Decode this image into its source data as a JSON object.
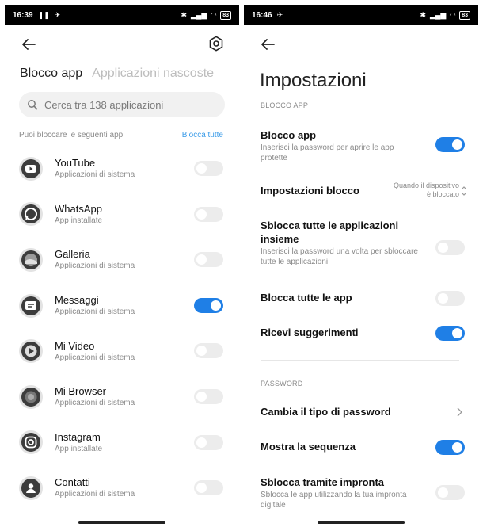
{
  "left": {
    "status": {
      "time": "16:39",
      "battery": "83"
    },
    "tabs": {
      "active": "Blocco app",
      "inactive": "Applicazioni nascoste"
    },
    "search": {
      "placeholder": "Cerca tra 138 applicazioni"
    },
    "list_hint": "Puoi bloccare le seguenti app",
    "lock_all_link": "Blocca tutte",
    "apps": [
      {
        "name": "YouTube",
        "sub": "Applicazioni di sistema",
        "enabled": false,
        "icon": "youtube-icon"
      },
      {
        "name": "WhatsApp",
        "sub": "App installate",
        "enabled": false,
        "icon": "whatsapp-icon"
      },
      {
        "name": "Galleria",
        "sub": "Applicazioni di sistema",
        "enabled": false,
        "icon": "gallery-icon"
      },
      {
        "name": "Messaggi",
        "sub": "Applicazioni di sistema",
        "enabled": true,
        "icon": "messages-icon"
      },
      {
        "name": "Mi Video",
        "sub": "Applicazioni di sistema",
        "enabled": false,
        "icon": "video-icon"
      },
      {
        "name": "Mi Browser",
        "sub": "Applicazioni di sistema",
        "enabled": false,
        "icon": "browser-icon"
      },
      {
        "name": "Instagram",
        "sub": "App installate",
        "enabled": false,
        "icon": "instagram-icon"
      },
      {
        "name": "Contatti",
        "sub": "Applicazioni di sistema",
        "enabled": false,
        "icon": "contacts-icon"
      }
    ]
  },
  "right": {
    "status": {
      "time": "16:46",
      "battery": "83"
    },
    "title": "Impostazioni",
    "section_app_lock": "BLOCCO APP",
    "section_password": "PASSWORD",
    "settings": {
      "app_lock": {
        "title": "Blocco app",
        "sub": "Inserisci la password per aprire le app protette",
        "enabled": true
      },
      "lock_settings": {
        "title": "Impostazioni blocco",
        "value_line1": "Quando il dispositivo",
        "value_line2": "è bloccato"
      },
      "unlock_all": {
        "title": "Sblocca tutte le applicazioni insieme",
        "sub": "Inserisci la password una volta per sbloccare tutte le applicazioni",
        "enabled": false
      },
      "lock_all": {
        "title": "Blocca tutte le app",
        "enabled": false
      },
      "suggestions": {
        "title": "Ricevi suggerimenti",
        "enabled": true
      },
      "change_password": {
        "title": "Cambia il tipo di password"
      },
      "show_pattern": {
        "title": "Mostra la sequenza",
        "enabled": true
      },
      "fingerprint": {
        "title": "Sblocca tramite impronta",
        "sub": "Sblocca le app utilizzando la tua impronta digitale",
        "enabled": false
      }
    }
  },
  "colors": {
    "accent": "#1f7fe6",
    "link": "#3a9be8",
    "toggle_off": "#ececec"
  }
}
